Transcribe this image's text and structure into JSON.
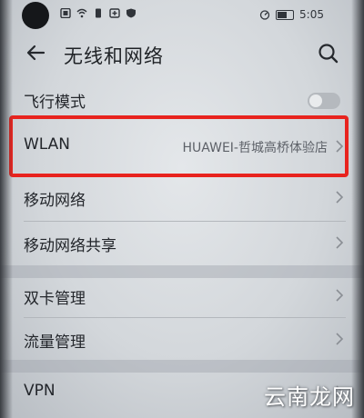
{
  "status_bar": {
    "time": "5:05",
    "icons": [
      "sim-icon",
      "wifi-icon",
      "notification-icon",
      "battery-saver-icon",
      "shield-icon"
    ]
  },
  "header": {
    "title": "无线和网络",
    "back_icon": "arrow-left-icon",
    "search_icon": "search-icon"
  },
  "settings": {
    "airplane": {
      "label": "飞行模式",
      "enabled": false
    },
    "wlan": {
      "label": "WLAN",
      "value": "HUAWEI-哲城高桥体验店"
    },
    "mobile_network": {
      "label": "移动网络"
    },
    "tethering": {
      "label": "移动网络共享"
    },
    "dual_sim": {
      "label": "双卡管理"
    },
    "data_usage": {
      "label": "流量管理"
    },
    "vpn": {
      "label": "VPN"
    }
  },
  "annotation": {
    "color": "#e8231e"
  },
  "watermark": "云南龙网"
}
